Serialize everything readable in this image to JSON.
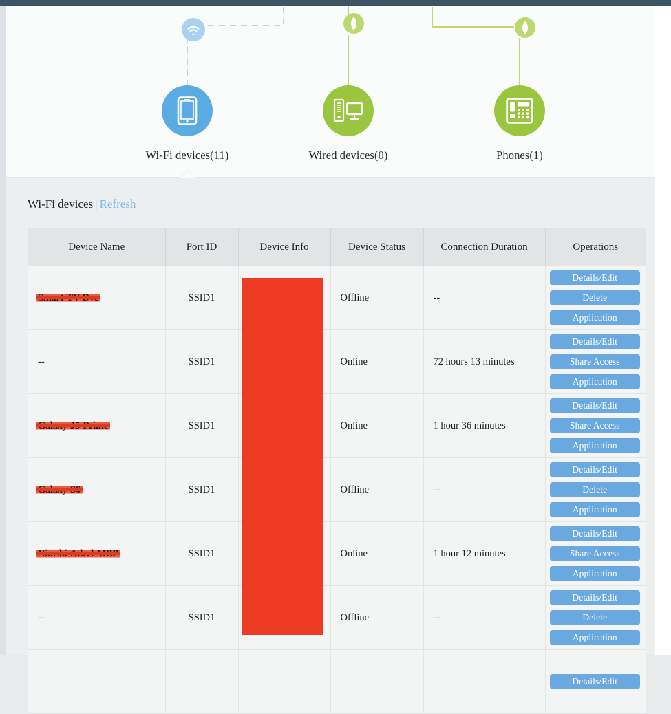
{
  "topology": {
    "nodes": [
      {
        "id": "wifi-devices",
        "label": "Wi-Fi devices(11)",
        "icon": "tablet-icon",
        "color": "#5aabe3",
        "link": "dashed"
      },
      {
        "id": "wired-devices",
        "label": "Wired devices(0)",
        "icon": "desktop-icon",
        "color": "#9ac63f",
        "link": "solid"
      },
      {
        "id": "phones",
        "label": "Phones(1)",
        "icon": "deskphone-icon",
        "color": "#9ac63f",
        "link": "solid"
      }
    ],
    "badges": [
      {
        "id": "wifi-badge",
        "icon": "wifi-icon",
        "color": "#a9d2f0"
      },
      {
        "id": "wired-badge",
        "icon": "plug-icon",
        "color": "#bcd870"
      },
      {
        "id": "phone-badge",
        "icon": "plug-icon",
        "color": "#bcd870"
      }
    ]
  },
  "devices_section": {
    "title": "Wi-Fi devices",
    "separator": "|",
    "refresh_label": "Refresh"
  },
  "table": {
    "columns": [
      "Device Name",
      "Port ID",
      "Device Info",
      "Device Status",
      "Connection Duration",
      "Operations"
    ],
    "rows": [
      {
        "device_name": "Smart-TV-Dve",
        "redacted": true,
        "port_id": "SSID1",
        "device_info": "",
        "device_status": "Offline",
        "connection_duration": "--",
        "operations": [
          "Details/Edit",
          "Delete",
          "Application"
        ]
      },
      {
        "device_name": "--",
        "redacted": false,
        "port_id": "SSID1",
        "device_info": "",
        "device_status": "Online",
        "connection_duration": "72 hours 13 minutes",
        "operations": [
          "Details/Edit",
          "Share Access",
          "Application"
        ]
      },
      {
        "device_name": "Galaxy-J5-Prime",
        "redacted": true,
        "port_id": "SSID1",
        "device_info": "",
        "device_status": "Online",
        "connection_duration": "1 hour 36 minutes",
        "operations": [
          "Details/Edit",
          "Share Access",
          "Application"
        ]
      },
      {
        "device_name": "Galaxy-S6",
        "redacted": true,
        "port_id": "SSID1",
        "device_info": "",
        "device_status": "Offline",
        "connection_duration": "--",
        "operations": [
          "Details/Edit",
          "Delete",
          "Application"
        ]
      },
      {
        "device_name": "Nimshi-Adeel-MBP",
        "redacted": true,
        "port_id": "SSID1",
        "device_info": "",
        "device_status": "Online",
        "connection_duration": "1 hour 12 minutes",
        "operations": [
          "Details/Edit",
          "Share Access",
          "Application"
        ]
      },
      {
        "device_name": "--",
        "redacted": false,
        "port_id": "SSID1",
        "device_info": "",
        "device_status": "Offline",
        "connection_duration": "--",
        "operations": [
          "Details/Edit",
          "Delete",
          "Application"
        ]
      },
      {
        "device_name": "",
        "redacted": false,
        "port_id": "",
        "device_info": "",
        "device_status": "",
        "connection_duration": "",
        "operations": [
          "Details/Edit"
        ]
      }
    ]
  },
  "colors": {
    "topbar": "#3b5567",
    "accent_blue": "#69a9e0",
    "node_blue": "#5aabe3",
    "node_green": "#9ac63f",
    "redaction_red": "#ee3b23",
    "link_text": "#7fb8e8"
  }
}
